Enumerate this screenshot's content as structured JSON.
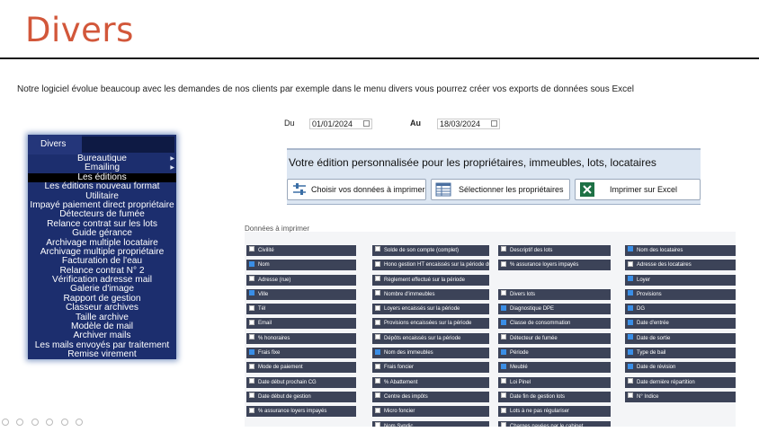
{
  "slide": {
    "title": "Divers",
    "intro": "Notre logiciel évolue beaucoup avec les demandes de nos clients par exemple dans le menu divers vous pourrez créer vos exports de données sous Excel"
  },
  "menu": {
    "tab_label": "Divers",
    "items": [
      {
        "label": "Bureautique",
        "submenu": true
      },
      {
        "label": "Emailing",
        "submenu": true
      },
      {
        "label": "Les éditions",
        "selected": true
      },
      {
        "label": "Les éditions nouveau format"
      },
      {
        "label": "Utilitaire"
      },
      {
        "label": "Impayé paiement direct propriétaire"
      },
      {
        "label": "Détecteurs de fumée"
      },
      {
        "label": "Relance contrat sur les lots"
      },
      {
        "label": "Guide gérance"
      },
      {
        "label": "Archivage multiple locataire"
      },
      {
        "label": "Archivage multiple propriétaire"
      },
      {
        "label": "Facturation de l'eau"
      },
      {
        "label": "Relance contrat N° 2"
      },
      {
        "label": "Vérification adresse mail"
      },
      {
        "label": "Galerie d'image"
      },
      {
        "label": "Rapport de gestion"
      },
      {
        "label": "Classeur archives"
      },
      {
        "label": "Taille archive"
      },
      {
        "label": "Modèle de mail"
      },
      {
        "label": "Archiver mails"
      },
      {
        "label": "Les mails envoyés par traitement"
      },
      {
        "label": "Remise virement"
      }
    ]
  },
  "editor": {
    "date_from_label": "Du",
    "date_from": "01/01/2024",
    "date_to_label": "Au",
    "date_to": "18/03/2024",
    "heading": "Votre édition personnalisée pour les propriétaires, immeubles, lots, locataires",
    "buttons": {
      "choose": "Choisir vos données à imprimer",
      "select_owners": "Sélectionner les propriétaires",
      "print_excel": "Imprimer sur Excel"
    },
    "fields_label": "Données à imprimer",
    "columns": [
      [
        {
          "label": "Civilité",
          "checked": false
        },
        {
          "label": "Nom",
          "checked": true
        },
        {
          "label": "Adresse (rue)",
          "checked": false
        },
        {
          "label": "Ville",
          "checked": true
        },
        {
          "label": "Tél",
          "checked": false
        },
        {
          "label": "Email",
          "checked": false
        },
        {
          "label": "% honoraires",
          "checked": false
        },
        {
          "label": "Frais fixe",
          "checked": true
        },
        {
          "label": "Mode de paiement",
          "checked": false
        },
        {
          "label": "Date début prochain CG",
          "checked": false
        },
        {
          "label": "Date début de gestion",
          "checked": false
        },
        {
          "label": "% assurance loyers impayés",
          "checked": false
        }
      ],
      [
        {
          "label": "Solde de son compte (complet)",
          "checked": false
        },
        {
          "label": "Hono gestion HT encaissés sur la période du au",
          "checked": false
        },
        {
          "label": "Règlement effectué sur la période",
          "checked": false
        },
        {
          "label": "Nombre d'immeubles",
          "checked": false
        },
        {
          "label": "Loyers encaissés sur la période",
          "checked": false
        },
        {
          "label": "Provisions encaissées sur la période",
          "checked": false
        },
        {
          "label": "Dépôts encaissés sur la période",
          "checked": false
        },
        {
          "label": "Nom des immeubles",
          "checked": true
        },
        {
          "label": "Frais foncier",
          "checked": false
        },
        {
          "label": "% Abattement",
          "checked": false
        },
        {
          "label": "Centre des impôts",
          "checked": false
        },
        {
          "label": "Micro foncier",
          "checked": false
        },
        {
          "label": "Nom Syndic",
          "checked": false
        }
      ],
      [
        {
          "label": "Descriptif des lots",
          "checked": false
        },
        {
          "label": "% assurance loyers impayés",
          "checked": false
        },
        {
          "label": "",
          "empty": true
        },
        {
          "label": "Divers lots",
          "checked": false
        },
        {
          "label": "Diagnostique DPE",
          "checked": true
        },
        {
          "label": "Classe de consommation",
          "checked": true
        },
        {
          "label": "Détecteur de fumée",
          "checked": false
        },
        {
          "label": "Période",
          "checked": true
        },
        {
          "label": "Meublé",
          "checked": true
        },
        {
          "label": "Loi Pinel",
          "checked": false
        },
        {
          "label": "Date fin de gestion lots",
          "checked": false
        },
        {
          "label": "Lots à ne pas régulariser",
          "checked": false
        },
        {
          "label": "Charges payées par le cabinet",
          "checked": false
        }
      ],
      [
        {
          "label": "Nom des locataires",
          "checked": true
        },
        {
          "label": "Adresse des locataires",
          "checked": false
        },
        {
          "label": "Loyer",
          "checked": true
        },
        {
          "label": "Provisions",
          "checked": true
        },
        {
          "label": "DG",
          "checked": true
        },
        {
          "label": "Date d'entrée",
          "checked": true
        },
        {
          "label": "Date de sortie",
          "checked": true
        },
        {
          "label": "Type de bail",
          "checked": true
        },
        {
          "label": "Date de révision",
          "checked": true
        },
        {
          "label": "Date dernière répartition",
          "checked": false
        },
        {
          "label": "N° Indice",
          "checked": false
        }
      ]
    ]
  },
  "colors": {
    "title": "#d2573a",
    "menu_bg": "#1c2e6e",
    "cell_bg": "#3c4358",
    "checkbox_on": "#3a8ee6"
  }
}
